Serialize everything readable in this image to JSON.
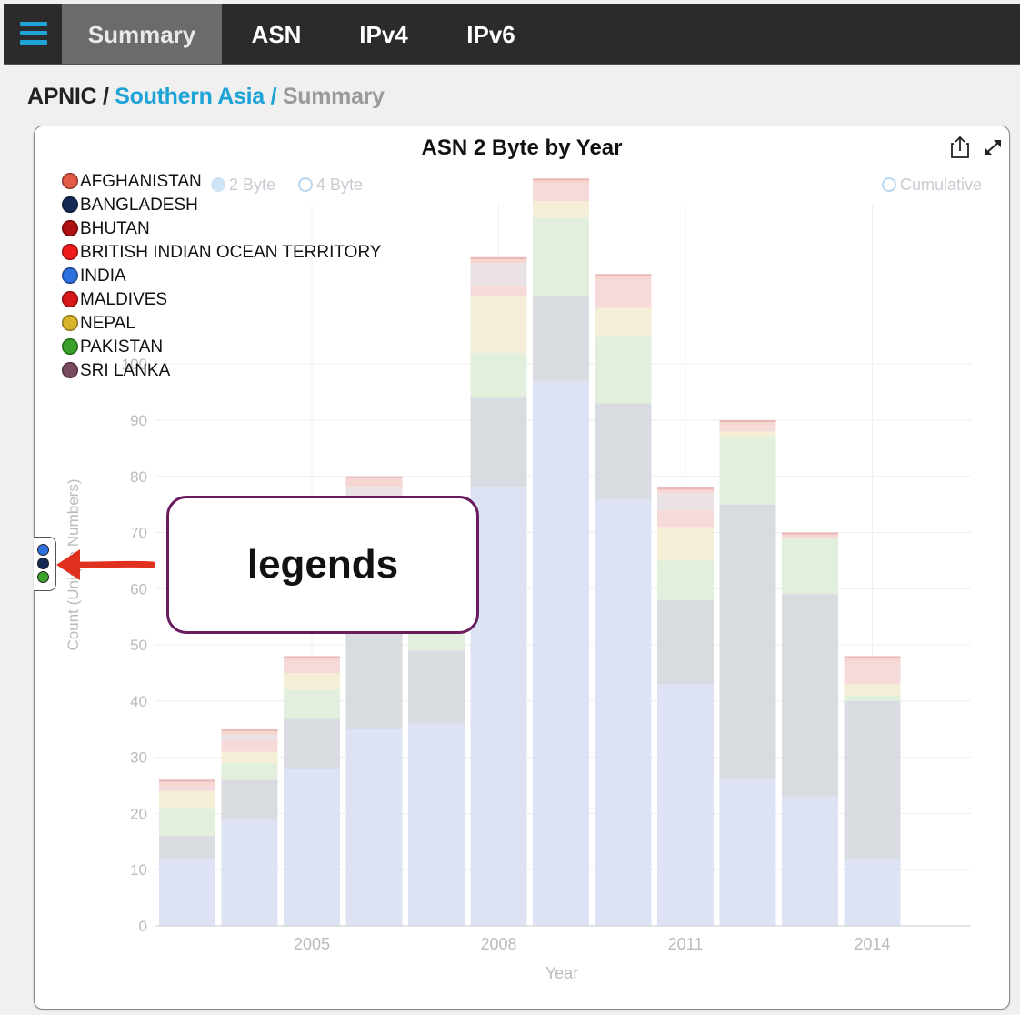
{
  "nav": {
    "menu_icon": "hamburger-menu-icon",
    "tabs": [
      {
        "label": "Summary",
        "active": true
      },
      {
        "label": "ASN",
        "active": false
      },
      {
        "label": "IPv4",
        "active": false
      },
      {
        "label": "IPv6",
        "active": false
      }
    ]
  },
  "breadcrumb": {
    "root": "APNIC",
    "separator": "/",
    "link": "Southern Asia",
    "current": "Summary"
  },
  "panel": {
    "share_icon": "share-icon",
    "expand_icon": "expand-icon"
  },
  "controls": {
    "byte2": "2 Byte",
    "byte4": "4 Byte",
    "cumulative": "Cumulative"
  },
  "legend": {
    "items": [
      {
        "label": "AFGHANISTAN",
        "color": "#e05a45"
      },
      {
        "label": "BANGLADESH",
        "color": "#142a55"
      },
      {
        "label": "BHUTAN",
        "color": "#b01010"
      },
      {
        "label": "BRITISH INDIAN OCEAN TERRITORY",
        "color": "#ee1c1c"
      },
      {
        "label": "INDIA",
        "color": "#2d6fdc"
      },
      {
        "label": "MALDIVES",
        "color": "#d81818"
      },
      {
        "label": "NEPAL",
        "color": "#d8b42a"
      },
      {
        "label": "PAKISTAN",
        "color": "#3aa22a"
      },
      {
        "label": "SRI LANKA",
        "color": "#7a4a60"
      }
    ],
    "toggle_colors": [
      "#2d6fdc",
      "#142a55",
      "#3aa22a"
    ]
  },
  "annotation": {
    "text": "legends",
    "arrow_color": "#e0301e",
    "border_color": "#6a1b5e"
  },
  "chart_data": {
    "type": "bar",
    "stacked": true,
    "title": "ASN 2 Byte by Year",
    "xlabel": "Year",
    "ylabel": "Count (Unique Numbers)",
    "ylim": [
      0,
      135
    ],
    "yticks": [
      0,
      10,
      20,
      30,
      40,
      50,
      60,
      70,
      80,
      90,
      100
    ],
    "xticks": [
      "2005",
      "2008",
      "2011",
      "2014"
    ],
    "grid": true,
    "legend_position": "top-left",
    "x": [
      2003,
      2004,
      2005,
      2006,
      2007,
      2008,
      2009,
      2010,
      2011,
      2012,
      2013,
      2014
    ],
    "series": [
      {
        "name": "INDIA",
        "color": "#dde3f4",
        "values": [
          12,
          19,
          28,
          35,
          36,
          78,
          97,
          76,
          43,
          26,
          23,
          12
        ]
      },
      {
        "name": "BANGLADESH",
        "color": "#d8dbdf",
        "values": [
          4,
          7,
          9,
          20,
          13,
          16,
          15,
          17,
          15,
          49,
          36,
          28
        ]
      },
      {
        "name": "PAKISTAN",
        "color": "#e1efdc",
        "values": [
          5,
          3,
          5,
          9,
          4,
          8,
          14,
          12,
          7,
          12,
          10,
          1
        ]
      },
      {
        "name": "NEPAL",
        "color": "#f5efd8",
        "values": [
          3,
          2,
          3,
          7,
          5,
          10,
          3,
          5,
          6,
          1,
          0,
          2
        ]
      },
      {
        "name": "MALDIVES",
        "color": "#f6dada",
        "values": [
          1,
          2,
          2,
          5,
          4,
          2,
          3,
          5,
          3,
          1,
          0,
          4
        ]
      },
      {
        "name": "SRI LANKA",
        "color": "#ebe2e6",
        "values": [
          0,
          1,
          0,
          2,
          3,
          4,
          0,
          0,
          3,
          0,
          0,
          0
        ]
      },
      {
        "name": "AFGHANISTAN",
        "color": "#f5d6d0",
        "values": [
          1,
          1,
          1,
          2,
          2,
          1,
          1,
          1,
          1,
          1,
          1,
          1
        ]
      }
    ]
  }
}
